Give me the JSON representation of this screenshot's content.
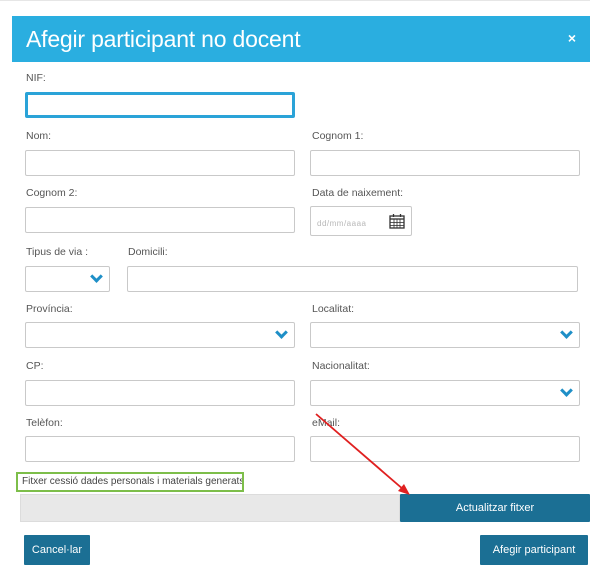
{
  "dialog": {
    "title": "Afegir participant no docent",
    "close_label": "×"
  },
  "fields": {
    "nif": {
      "label": "NIF:",
      "value": ""
    },
    "nom": {
      "label": "Nom:",
      "value": ""
    },
    "cognom1": {
      "label": "Cognom 1:",
      "value": ""
    },
    "cognom2": {
      "label": "Cognom 2:",
      "value": ""
    },
    "data_naixement": {
      "label": "Data de naixement:",
      "placeholder": "dd/mm/aaaa"
    },
    "tipus_via": {
      "label": "Tipus de via :",
      "value": ""
    },
    "domicili": {
      "label": "Domicili:",
      "value": ""
    },
    "provincia": {
      "label": "Província:",
      "value": ""
    },
    "localitat": {
      "label": "Localitat:",
      "value": ""
    },
    "cp": {
      "label": "CP:",
      "value": ""
    },
    "nacionalitat": {
      "label": "Nacionalitat:",
      "value": ""
    },
    "telefon": {
      "label": "Telèfon:",
      "value": ""
    },
    "email": {
      "label": "eMail:",
      "value": ""
    }
  },
  "file": {
    "label": "Fitxer cessió dades personals i materials generats:",
    "update_button": "Actualitzar fitxer"
  },
  "buttons": {
    "cancel": "Cancel·lar",
    "add": "Afegir participant"
  },
  "colors": {
    "header": "#2aaee0",
    "button": "#1b6f94",
    "highlight_border": "#7dbe4a",
    "annotation_arrow": "#e02020"
  }
}
